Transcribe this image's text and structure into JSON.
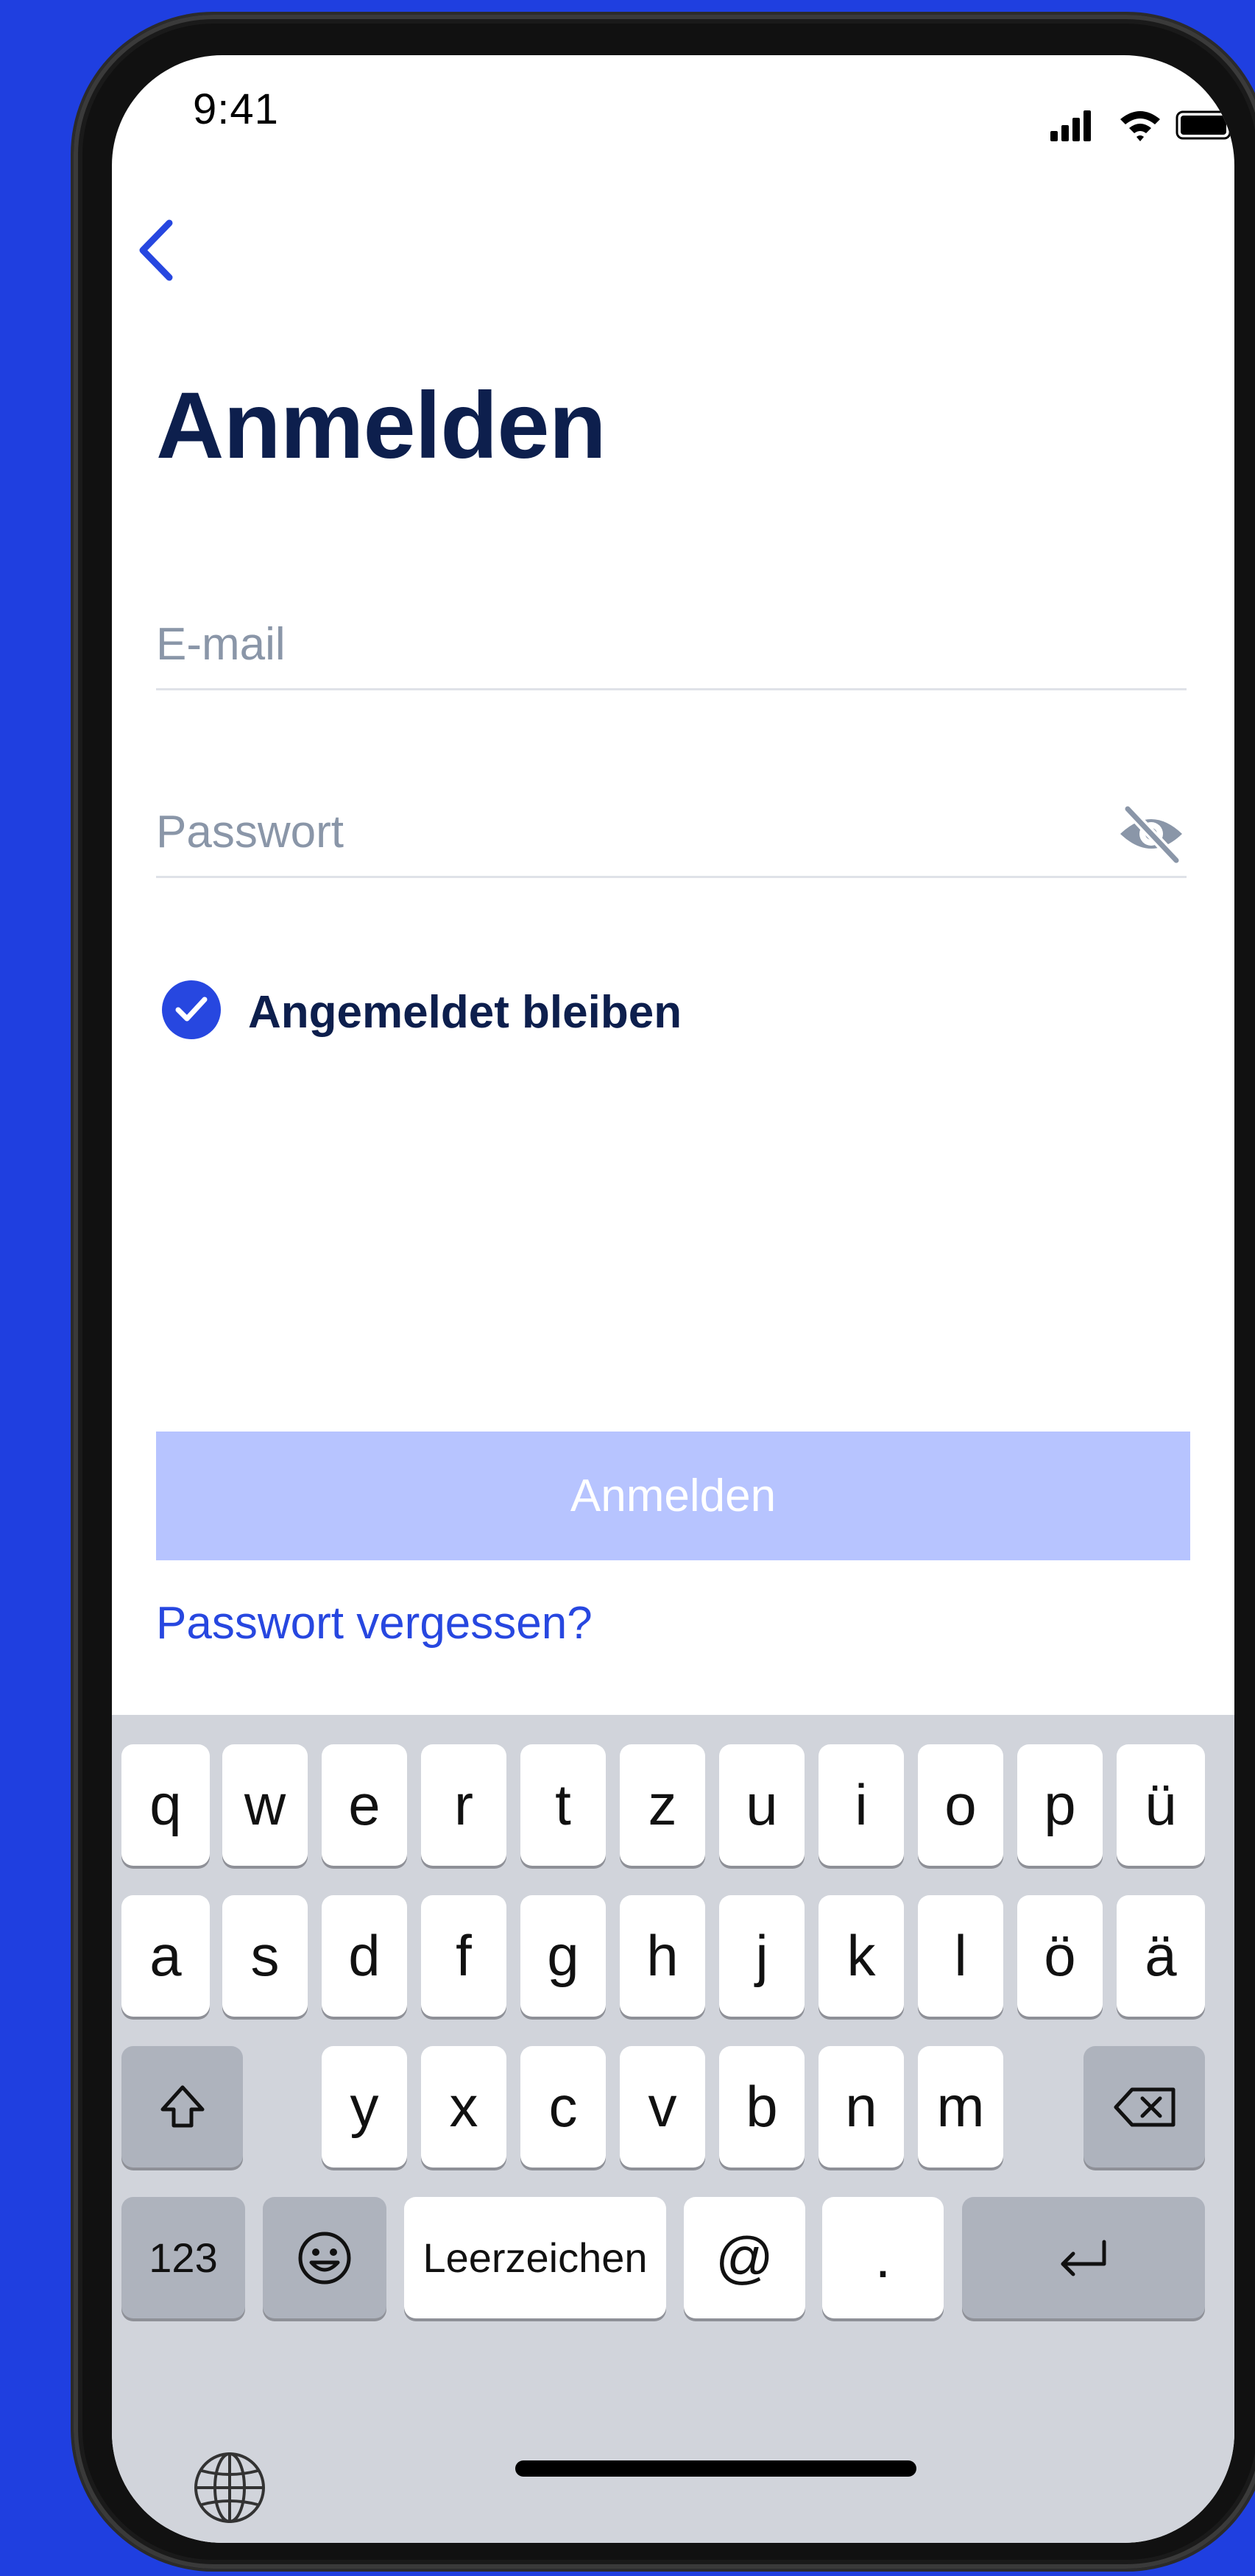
{
  "status_bar": {
    "time": "9:41"
  },
  "header": {
    "title": "Anmelden"
  },
  "form": {
    "email_placeholder": "E-mail",
    "password_placeholder": "Passwort",
    "remember_label": "Angemeldet bleiben",
    "remember_checked": true,
    "submit_label": "Anmelden",
    "forgot_link": "Passwort vergessen?"
  },
  "keyboard": {
    "row1": [
      "q",
      "w",
      "e",
      "r",
      "t",
      "z",
      "u",
      "i",
      "o",
      "p",
      "ü"
    ],
    "row2": [
      "a",
      "s",
      "d",
      "f",
      "g",
      "h",
      "j",
      "k",
      "l",
      "ö",
      "ä"
    ],
    "row3": [
      "y",
      "x",
      "c",
      "v",
      "b",
      "n",
      "m"
    ],
    "numbers_key": "123",
    "space_key": "Leerzeichen",
    "at_key": "@",
    "dot_key": "."
  },
  "colors": {
    "accent": "#2747e0",
    "title": "#0d1f4d",
    "background": "#1f3fe0",
    "button_disabled": "#b7c4ff"
  }
}
